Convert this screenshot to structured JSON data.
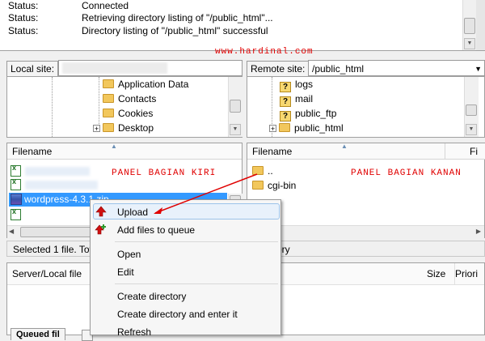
{
  "watermark": "www.hardinal.com",
  "log": [
    {
      "label": "Status:",
      "msg": "Connected"
    },
    {
      "label": "Status:",
      "msg": "Retrieving directory listing of \"/public_html\"..."
    },
    {
      "label": "Status:",
      "msg": "Directory listing of \"/public_html\" successful"
    }
  ],
  "local": {
    "site_label": "Local site:",
    "tree": [
      "Application Data",
      "Contacts",
      "Cookies",
      "Desktop"
    ],
    "filename_header": "Filename",
    "annotation": "PANEL BAGIAN KIRI",
    "selected_file": "wordpress-4.3.1.zip",
    "status": "Selected 1 file. Tota"
  },
  "remote": {
    "site_label": "Remote site:",
    "path": "/public_html",
    "tree": [
      "logs",
      "mail",
      "public_ftp",
      "public_html"
    ],
    "filename_header": "Filename",
    "filesize_header": "Fi",
    "annotation": "PANEL BAGIAN KANAN",
    "files": [
      "..",
      "cgi-bin"
    ],
    "status": "ory"
  },
  "queue": {
    "server_local_header": "Server/Local file",
    "size_header": "Size",
    "priority_header": "Priori",
    "tab": "Queued fil"
  },
  "context_menu": {
    "items": [
      "Upload",
      "Add files to queue",
      "Open",
      "Edit",
      "Create directory",
      "Create directory and enter it",
      "Refresh"
    ]
  },
  "colors": {
    "annotation": "#e00000",
    "selection": "#3399ff",
    "upload_arrow": "#d01010"
  }
}
